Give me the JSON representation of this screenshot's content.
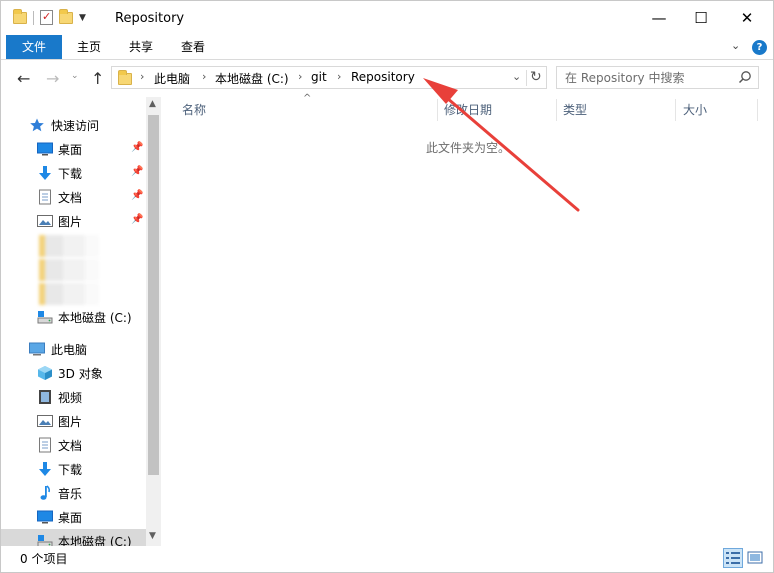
{
  "window": {
    "title": "Repository",
    "controls": {
      "minimize": "—",
      "maximize": "☐",
      "close": "✕"
    }
  },
  "ribbon": {
    "tabs": [
      {
        "label": "文件",
        "active": true
      },
      {
        "label": "主页"
      },
      {
        "label": "共享"
      },
      {
        "label": "查看"
      }
    ],
    "accent": "#1979ca"
  },
  "nav": {
    "back": "←",
    "forward": "→",
    "recent": "⌄",
    "up": "↑",
    "breadcrumb": [
      "此电脑",
      "本地磁盘 (C:)",
      "git",
      "Repository"
    ],
    "crumb_sep": "›",
    "dropdown": "⌄",
    "refresh": "↻"
  },
  "search": {
    "placeholder": "在 Repository 中搜索"
  },
  "sidebar": {
    "quick_access": {
      "label": "快速访问",
      "items": [
        {
          "label": "桌面",
          "icon": "desktop-icon",
          "pinned": true
        },
        {
          "label": "下载",
          "icon": "download-icon",
          "pinned": true
        },
        {
          "label": "文档",
          "icon": "document-icon",
          "pinned": true
        },
        {
          "label": "图片",
          "icon": "picture-icon",
          "pinned": true
        }
      ],
      "drive_label": "本地磁盘 (C:)"
    },
    "this_pc": {
      "label": "此电脑",
      "items": [
        {
          "label": "3D 对象",
          "icon": "3d-objects-icon"
        },
        {
          "label": "视频",
          "icon": "video-icon"
        },
        {
          "label": "图片",
          "icon": "picture-icon"
        },
        {
          "label": "文档",
          "icon": "document-icon"
        },
        {
          "label": "下载",
          "icon": "download-icon"
        },
        {
          "label": "音乐",
          "icon": "music-icon"
        },
        {
          "label": "桌面",
          "icon": "desktop-icon"
        },
        {
          "label": "本地磁盘 (C:)",
          "icon": "drive-icon"
        }
      ]
    },
    "pin_glyph": "📌"
  },
  "content": {
    "columns": [
      "名称",
      "修改日期",
      "类型",
      "大小"
    ],
    "sort_glyph": "^",
    "empty_message": "此文件夹为空。"
  },
  "status": {
    "item_count": "0 个项目"
  },
  "annotation": {
    "arrow_color": "#e8403a"
  }
}
